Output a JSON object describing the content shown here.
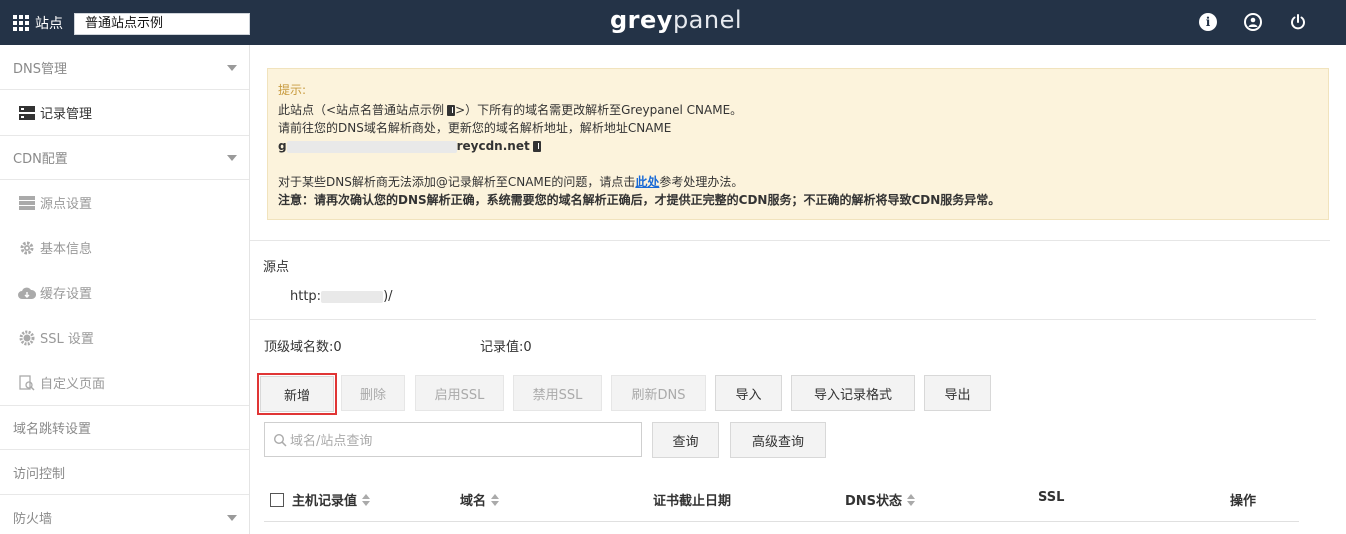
{
  "topbar": {
    "site_label": "站点",
    "site_value": "普通站点示例",
    "brand_left": "grey",
    "brand_right": "panel"
  },
  "sidebar": {
    "dns": "DNS管理",
    "record": "记录管理",
    "cdn": "CDN配置",
    "origin": "源点设置",
    "basic": "基本信息",
    "cache": "缓存设置",
    "ssl": "SSL 设置",
    "custom": "自定义页面",
    "redirect": "域名跳转设置",
    "access": "访问控制",
    "firewall": "防火墙"
  },
  "notice": {
    "title": "提示:",
    "line1_a": "此站点（<站点名普通站点示例",
    "line1_b": ">）下所有的域名需更改解析至Greypanel CNAME。",
    "line2": "请前往您的DNS域名解析商处，更新您的域名解析地址，解析地址CNAME",
    "cname_prefix": "g",
    "cname_suffix": "reycdn.net",
    "line4_a": "对于某些DNS解析商无法添加@记录解析至CNAME的问题，请点击",
    "line4_link": "此处",
    "line4_b": "参考处理办法。",
    "line5": "注意：请再次确认您的DNS解析正确，系统需要您的域名解析正确后，才提供正完整的CDN服务；不正确的解析将导致CDN服务异常。"
  },
  "origin": {
    "title": "源点",
    "url_prefix": "http:",
    "url_suffix": ")/"
  },
  "stats": {
    "top_domains": "顶级域名数:0",
    "records": "记录值:0"
  },
  "buttons": {
    "add": "新增",
    "delete": "删除",
    "enable_ssl": "启用SSL",
    "disable_ssl": "禁用SSL",
    "refresh_dns": "刷新DNS",
    "import": "导入",
    "import_format": "导入记录格式",
    "export": "导出",
    "query": "查询",
    "advanced_query": "高级查询"
  },
  "search": {
    "placeholder": "域名/站点查询"
  },
  "table": {
    "col_host": "主机记录值",
    "col_domain": "域名",
    "col_cert": "证书截止日期",
    "col_dns": "DNS状态",
    "col_ssl": "SSL",
    "col_ops": "操作"
  },
  "colors": {
    "topbar_bg": "#243347",
    "notice_bg": "#fcf3dc",
    "notice_title": "#c79a3e",
    "highlight": "#e03535",
    "link": "#1a6bd6"
  }
}
